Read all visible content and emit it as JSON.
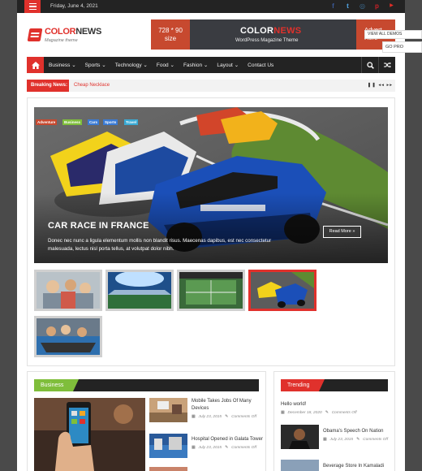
{
  "topbar": {
    "date": "Friday, June 4, 2021"
  },
  "social": [
    {
      "icon": "facebook-icon",
      "glyph": "f",
      "color": "#3b5998"
    },
    {
      "icon": "twitter-icon",
      "glyph": "t",
      "color": "#55acee"
    },
    {
      "icon": "instagram-icon",
      "glyph": "◎",
      "color": "#3f729b"
    },
    {
      "icon": "pinterest-icon",
      "glyph": "p",
      "color": "#cb2027"
    },
    {
      "icon": "youtube-icon",
      "glyph": "▶",
      "color": "#e52d27"
    }
  ],
  "logo": {
    "name_red": "COLOR",
    "name_dark": "NEWS",
    "tagline": "Magazine theme"
  },
  "ad": {
    "size_line1": "728 * 90",
    "size_line2": "size",
    "brand_white": "COLOR",
    "brand_red": "NEWS",
    "subtitle": "WordPress Magazine Theme",
    "right_line1": "Advert",
    "right_line2": "Here"
  },
  "side_buttons": {
    "demo": "VIEW ALL DEMOS",
    "pro": "GO PRO"
  },
  "nav": {
    "items": [
      "Business",
      "Sports",
      "Technology",
      "Food",
      "Fashion",
      "Layout",
      "Contact Us"
    ],
    "dropdown_flags": [
      true,
      true,
      true,
      true,
      true,
      true,
      false
    ]
  },
  "breaking": {
    "label": "Breaking News:",
    "text": "Cheap Necklace",
    "controls": "❚❚ ◂◂ ▸▸"
  },
  "featured": {
    "categories": [
      {
        "label": "Adventure",
        "color": "#c7492f"
      },
      {
        "label": "Business",
        "color": "#7fbe3b"
      },
      {
        "label": "Cars",
        "color": "#3a7bd5"
      },
      {
        "label": "Sports",
        "color": "#3a7bd5"
      },
      {
        "label": "Travel",
        "color": "#3aaad5"
      }
    ],
    "title": "CAR RACE IN FRANCE",
    "excerpt": "Donec nec nunc a ligula elementum mollis non blandit risus. Maecenas dapibus, est nec consectetur malesuada, lectus nisl porta tellus, at volutpat dolor nibh.",
    "read_more": "Read More »"
  },
  "colors": {
    "accent": "#e0312c",
    "dark": "#232323",
    "business": "#7fbe3b"
  },
  "business": {
    "heading": "Business",
    "posts": [
      {
        "title": "Mobile Takes Jobs Of Many Devices",
        "date": "July 23, 2015",
        "comments": "Comments Off"
      },
      {
        "title": "Hospital Opened in Galata Tower",
        "date": "July 23, 2015",
        "comments": "Comments Off"
      }
    ]
  },
  "trending": {
    "heading": "Trending",
    "posts": [
      {
        "title": "Hello world!",
        "date": "December 18, 2020",
        "comments": "Comments Off"
      },
      {
        "title": "Obama's Speech On Nation",
        "date": "July 23, 2015",
        "comments": "Comments Off"
      },
      {
        "title": "Beverage Store In Kamaladi",
        "date": "",
        "comments": ""
      }
    ]
  }
}
